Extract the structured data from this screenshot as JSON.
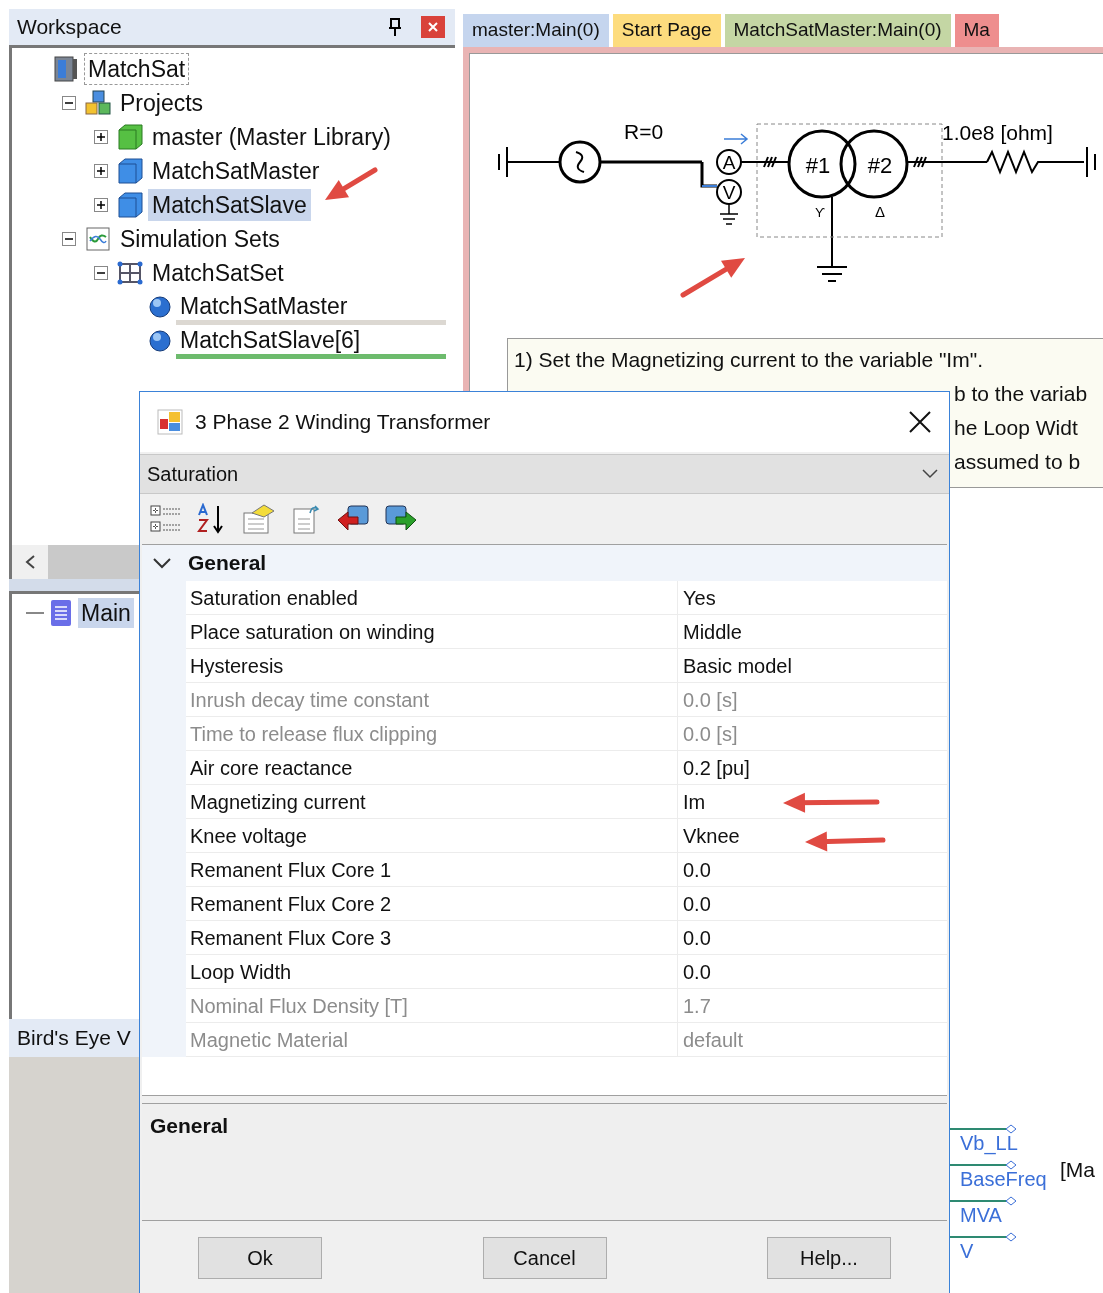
{
  "workspace": {
    "title": "Workspace",
    "tree": [
      {
        "label": "MatchSat",
        "kind": "workspace",
        "focused": true,
        "selected": false,
        "children": [
          {
            "label": "Projects",
            "kind": "projects",
            "expanded": true,
            "selected": false,
            "children": [
              {
                "label": "master (Master Library)",
                "kind": "library",
                "expanded": false,
                "selected": false
              },
              {
                "label": "MatchSatMaster",
                "kind": "project",
                "expanded": false,
                "selected": false
              },
              {
                "label": "MatchSatSlave",
                "kind": "project",
                "expanded": false,
                "selected": true
              }
            ]
          },
          {
            "label": "Simulation Sets",
            "kind": "simsets",
            "expanded": true,
            "selected": false,
            "children": [
              {
                "label": "MatchSatSet",
                "kind": "set",
                "expanded": true,
                "selected": false,
                "children": [
                  {
                    "label": "MatchSatMaster",
                    "kind": "task",
                    "selected": false,
                    "color": "#dcd8d2"
                  },
                  {
                    "label": "MatchSatSlave[6]",
                    "kind": "task",
                    "selected": false,
                    "color": "#6dbb6d"
                  }
                ]
              }
            ]
          }
        ]
      }
    ]
  },
  "pages": {
    "tree": [
      {
        "label": "Main",
        "kind": "page",
        "selected": true
      }
    ]
  },
  "birds_eye": {
    "title": "Bird's Eye V"
  },
  "tabs": [
    {
      "label": "master:Main(0)",
      "color": "#c5d5ee"
    },
    {
      "label": "Start Page",
      "color": "#fddc7e"
    },
    {
      "label": "MatchSatMaster:Main(0)",
      "color": "#c4d6a4"
    },
    {
      "label": "Ma",
      "color": "#ee8e8e"
    }
  ],
  "schematic": {
    "resistance": "R=0",
    "load": "1.0e8 [ohm]",
    "ammeter": "A",
    "voltmeter": "V",
    "winding_1": "#1",
    "winding_2": "#2",
    "winding_1_type": "ϒ",
    "winding_2_type": "Δ"
  },
  "note": {
    "lines": [
      "1) Set the Magnetizing current to the variable \"Im\".",
      "b to the variab",
      "he Loop Widt",
      "assumed to b"
    ]
  },
  "ports": {
    "labels": [
      "Vb_LL",
      "BaseFreq",
      "MVA",
      "V"
    ],
    "block_label": "[Ma"
  },
  "dialog": {
    "title": "3 Phase 2 Winding Transformer",
    "section": "Saturation",
    "categories": [
      {
        "label": "General",
        "expanded": true,
        "rows": [
          {
            "name": "Saturation enabled",
            "value": "Yes",
            "disabled": false
          },
          {
            "name": "Place saturation on winding",
            "value": "Middle",
            "disabled": false
          },
          {
            "name": "Hysteresis",
            "value": "Basic model",
            "disabled": false
          },
          {
            "name": "Inrush decay time constant",
            "value": "0.0 [s]",
            "disabled": true
          },
          {
            "name": "Time to release flux clipping",
            "value": "0.0 [s]",
            "disabled": true
          },
          {
            "name": "Air core reactance",
            "value": "0.2 [pu]",
            "disabled": false
          },
          {
            "name": "Magnetizing current",
            "value": "Im",
            "disabled": false
          },
          {
            "name": "Knee voltage",
            "value": "Vknee",
            "disabled": false
          },
          {
            "name": "Remanent Flux Core 1",
            "value": "0.0",
            "disabled": false
          },
          {
            "name": "Remanent Flux Core 2",
            "value": "0.0",
            "disabled": false
          },
          {
            "name": "Remanent Flux Core 3",
            "value": "0.0",
            "disabled": false
          },
          {
            "name": "Loop Width",
            "value": "0.0",
            "disabled": false
          },
          {
            "name": "Nominal Flux Density [T]",
            "value": "1.7",
            "disabled": true
          },
          {
            "name": "Magnetic Material",
            "value": "default",
            "disabled": true
          }
        ]
      }
    ],
    "description": {
      "title": "General"
    },
    "buttons": [
      "Ok",
      "Cancel",
      "Help..."
    ]
  }
}
